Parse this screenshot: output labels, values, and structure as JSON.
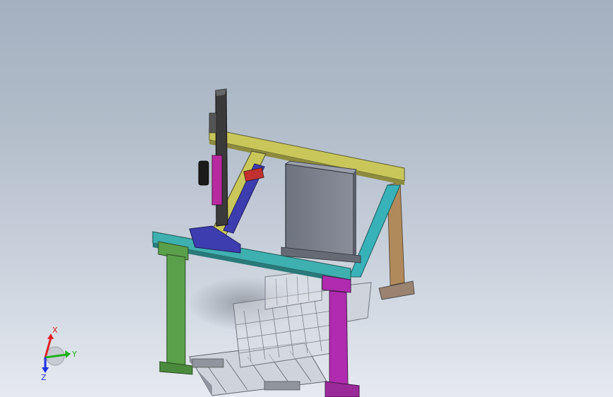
{
  "viewport": {
    "background_top": "#a4b0c0",
    "background_bottom": "#e6eaf0"
  },
  "model": {
    "parts": [
      {
        "name": "gantry-rail-back",
        "color": "#c9c75a"
      },
      {
        "name": "gantry-rail-front-left",
        "color": "#3fb0b0"
      },
      {
        "name": "gantry-rail-right",
        "color": "#37b2b8"
      },
      {
        "name": "column-front-left",
        "color": "#5aa04a"
      },
      {
        "name": "column-front-right",
        "color": "#b02bb0"
      },
      {
        "name": "column-back-right",
        "color": "#b08a5a"
      },
      {
        "name": "vertical-z-axis",
        "color": "#3a3a3a"
      },
      {
        "name": "y-axis-carriage",
        "color": "#3d3db0"
      },
      {
        "name": "control-cabinet",
        "color": "#7e818e"
      },
      {
        "name": "pallet",
        "color": "#d8dce2"
      }
    ]
  },
  "triad": {
    "x_label": "X",
    "y_label": "Y",
    "z_label": "Z",
    "x_color": "#e02020",
    "y_color": "#20b020",
    "z_color": "#2030e0"
  }
}
